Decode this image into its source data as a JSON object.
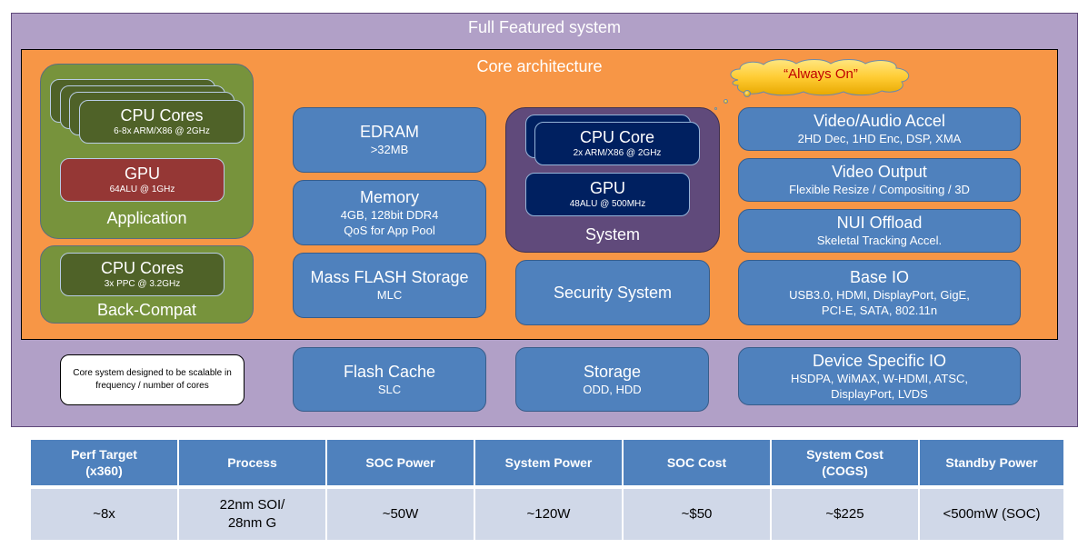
{
  "outer": {
    "title": "Full Featured system"
  },
  "core": {
    "title": "Core architecture"
  },
  "cloud": {
    "text": "“Always On”"
  },
  "application": {
    "label": "Application",
    "cpu": {
      "title": "CPU Cores",
      "sub": "6-8x ARM/X86 @ 2GHz"
    },
    "gpu": {
      "title": "GPU",
      "sub": "64ALU @ 1GHz"
    }
  },
  "back_compat": {
    "label": "Back-Compat",
    "cpu": {
      "title": "CPU Cores",
      "sub": "3x PPC @ 3.2GHz"
    }
  },
  "memory_column": [
    {
      "title": "EDRAM",
      "lines": [
        ">32MB"
      ]
    },
    {
      "title": "Memory",
      "lines": [
        "4GB, 128bit DDR4",
        "QoS for App Pool"
      ]
    },
    {
      "title": "Mass FLASH Storage",
      "lines": [
        "MLC"
      ]
    }
  ],
  "system": {
    "label": "System",
    "cpu": {
      "title": "CPU Core",
      "sub": "2x ARM/X86 @ 2GHz"
    },
    "gpu": {
      "title": "GPU",
      "sub": "48ALU @ 500MHz"
    }
  },
  "security": {
    "title": "Security System"
  },
  "io_column": [
    {
      "title": "Video/Audio Accel",
      "lines": [
        "2HD Dec, 1HD Enc, DSP, XMA"
      ]
    },
    {
      "title": "Video Output",
      "lines": [
        "Flexible Resize / Compositing / 3D"
      ]
    },
    {
      "title": "NUI Offload",
      "lines": [
        "Skeletal Tracking Accel."
      ]
    },
    {
      "title": "Base IO",
      "lines": [
        "USB3.0, HDMI, DisplayPort, GigE,",
        "PCI-E, SATA, 802.11n"
      ]
    }
  ],
  "outside_core": {
    "note": "Core system designed to be scalable in frequency / number of cores",
    "flash_cache": {
      "title": "Flash Cache",
      "lines": [
        "SLC"
      ]
    },
    "storage": {
      "title": "Storage",
      "lines": [
        "ODD, HDD"
      ]
    },
    "device_io": {
      "title": "Device Specific IO",
      "lines": [
        "HSDPA, WiMAX, W-HDMI, ATSC,",
        "DisplayPort, LVDS"
      ]
    }
  },
  "spec_table": {
    "headers": [
      [
        "Perf Target",
        "(x360)"
      ],
      [
        "Process"
      ],
      [
        "SOC Power"
      ],
      [
        "System Power"
      ],
      [
        "SOC Cost"
      ],
      [
        "System Cost",
        "(COGS)"
      ],
      [
        "Standby Power"
      ]
    ],
    "row": [
      [
        "~8x"
      ],
      [
        "22nm SOI/",
        "28nm G"
      ],
      [
        "~50W"
      ],
      [
        "~120W"
      ],
      [
        "~$50"
      ],
      [
        "~$225"
      ],
      [
        "<500mW (SOC)"
      ]
    ]
  },
  "colors": {
    "outer_frame": "#b1a0c7",
    "core_frame": "#f79646",
    "application_group": "#77933c",
    "cpu_cores": "#4f6228",
    "app_gpu": "#953735",
    "system_group": "#604a7b",
    "system_blocks": "#002060",
    "blue_blocks": "#4f81bd",
    "table_header": "#4f81bd",
    "table_body": "#d0d8e8",
    "cloud_text": "#c00000"
  }
}
